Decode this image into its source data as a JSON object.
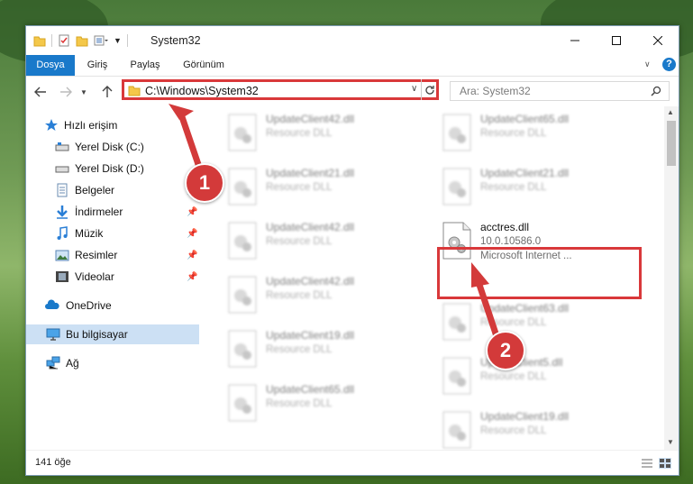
{
  "window": {
    "title": "System32",
    "controls": {
      "minimize_icon": "minimize-icon",
      "maximize_icon": "maximize-icon",
      "close_icon": "close-icon"
    }
  },
  "ribbon": {
    "tabs": [
      {
        "label": "Dosya",
        "active": true
      },
      {
        "label": "Giriş",
        "active": false
      },
      {
        "label": "Paylaş",
        "active": false
      },
      {
        "label": "Görünüm",
        "active": false
      }
    ],
    "help_icon": "help-icon"
  },
  "address": {
    "path": "C:\\Windows\\System32",
    "search_placeholder": "Ara: System32"
  },
  "sidebar": {
    "items": [
      {
        "label": "Hızlı erişim",
        "icon": "star-icon",
        "pinned": false
      },
      {
        "label": "Yerel Disk (C:)",
        "icon": "drive-icon",
        "pinned": false
      },
      {
        "label": "Yerel Disk (D:)",
        "icon": "drive-icon",
        "pinned": false
      },
      {
        "label": "Belgeler",
        "icon": "document-icon",
        "pinned": true
      },
      {
        "label": "İndirmeler",
        "icon": "download-icon",
        "pinned": true
      },
      {
        "label": "Müzik",
        "icon": "music-icon",
        "pinned": true
      },
      {
        "label": "Resimler",
        "icon": "pictures-icon",
        "pinned": true
      },
      {
        "label": "Videolar",
        "icon": "video-icon",
        "pinned": true
      },
      {
        "label": "OneDrive",
        "icon": "cloud-icon",
        "pinned": false
      },
      {
        "label": "Bu bilgisayar",
        "icon": "computer-icon",
        "pinned": false,
        "selected": true
      },
      {
        "label": "Ağ",
        "icon": "network-icon",
        "pinned": false
      }
    ]
  },
  "files": {
    "left_column": [
      {
        "name": "UpdateClient42.dll",
        "type": "Resource DLL"
      },
      {
        "name": "UpdateClient21.dll",
        "type": "Resource DLL"
      },
      {
        "name": "UpdateClient42.dll",
        "type": "Resource DLL"
      },
      {
        "name": "UpdateClient42.dll",
        "type": "Resource DLL"
      },
      {
        "name": "UpdateClient19.dll",
        "type": "Resource DLL"
      },
      {
        "name": "UpdateClient65.dll",
        "type": "Resource DLL"
      }
    ],
    "right_column": [
      {
        "name": "UpdateClient65.dll",
        "type": "Resource DLL"
      },
      {
        "name": "UpdateClient21.dll",
        "type": "Resource DLL"
      },
      {
        "name": "UpdateClient63.dll",
        "type": "Resource DLL"
      },
      {
        "name": "UpdateClient5.dll",
        "type": "Resource DLL"
      },
      {
        "name": "UpdateClient19.dll",
        "type": "Resource DLL"
      }
    ],
    "highlighted": {
      "name": "acctres.dll",
      "version": "10.0.10586.0",
      "company": "Microsoft Internet ..."
    }
  },
  "status": {
    "item_count": "141 öğe"
  },
  "annotations": {
    "step1": "1",
    "step2": "2"
  },
  "colors": {
    "accent": "#1979ca",
    "highlight": "#d9383a",
    "selected": "#cce0f4"
  }
}
